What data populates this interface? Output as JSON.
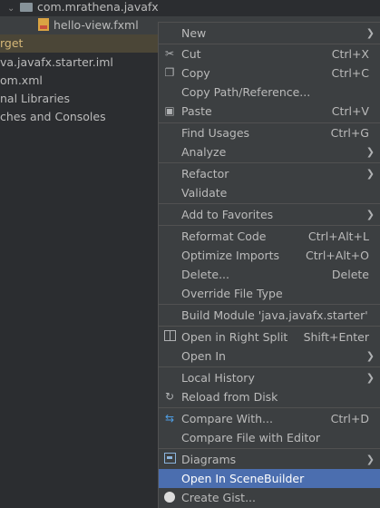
{
  "tree": {
    "rows": [
      {
        "text": "com.mrathena.javafx",
        "icon": "folder-icon"
      },
      {
        "text": "hello-view.fxml",
        "icon": "fxml-icon"
      },
      {
        "text": "rget"
      },
      {
        "text": "va.javafx.starter.iml"
      },
      {
        "text": "om.xml"
      },
      {
        "text": "nal Libraries"
      },
      {
        "text": "ches and Consoles"
      }
    ]
  },
  "menu": {
    "items": [
      {
        "label": "New",
        "shortcut": "",
        "submenu": true,
        "icon": ""
      },
      {
        "label": "Cut",
        "shortcut": "Ctrl+X",
        "icon": "scissors-icon"
      },
      {
        "label": "Copy",
        "shortcut": "Ctrl+C",
        "icon": "copy-icon"
      },
      {
        "label": "Copy Path/Reference...",
        "shortcut": ""
      },
      {
        "label": "Paste",
        "shortcut": "Ctrl+V",
        "icon": "clipboard-icon"
      },
      {
        "label": "Find Usages",
        "shortcut": "Ctrl+G"
      },
      {
        "label": "Analyze",
        "submenu": true
      },
      {
        "label": "Refactor",
        "submenu": true
      },
      {
        "label": "Validate",
        "shortcut": ""
      },
      {
        "label": "Add to Favorites",
        "submenu": true
      },
      {
        "label": "Reformat Code",
        "shortcut": "Ctrl+Alt+L"
      },
      {
        "label": "Optimize Imports",
        "shortcut": "Ctrl+Alt+O"
      },
      {
        "label": "Delete...",
        "shortcut": "Delete"
      },
      {
        "label": "Override File Type",
        "shortcut": ""
      },
      {
        "label": "Build Module 'java.javafx.starter'",
        "shortcut": ""
      },
      {
        "label": "Open in Right Split",
        "shortcut": "Shift+Enter",
        "icon": "split-icon"
      },
      {
        "label": "Open In",
        "submenu": true
      },
      {
        "label": "Local History",
        "submenu": true
      },
      {
        "label": "Reload from Disk",
        "shortcut": "",
        "icon": "reload-icon"
      },
      {
        "label": "Compare With...",
        "shortcut": "Ctrl+D",
        "icon": "compare-icon"
      },
      {
        "label": "Compare File with Editor",
        "shortcut": ""
      },
      {
        "label": "Diagrams",
        "submenu": true,
        "icon": "diagram-icon"
      },
      {
        "label": "Open In SceneBuilder",
        "shortcut": "",
        "active": true
      },
      {
        "label": "Create Gist...",
        "shortcut": "",
        "icon": "github-icon"
      }
    ]
  },
  "colors": {
    "menu_bg": "#3c3f41",
    "highlight": "#4b6eaf",
    "tree_bg": "#2b2d30",
    "text": "#bbbbbb"
  }
}
